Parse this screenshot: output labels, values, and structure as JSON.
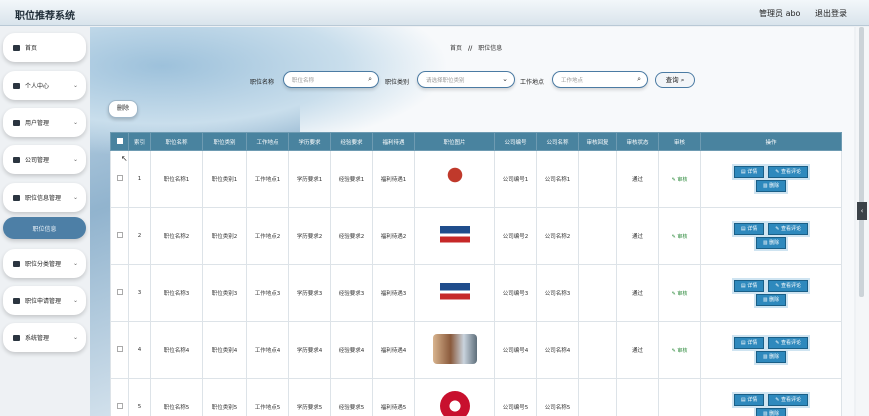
{
  "header": {
    "title": "职位推荐系统",
    "admin": "管理员 abo",
    "logout": "退出登录"
  },
  "sidebar": {
    "items": [
      {
        "label": "首页",
        "icon": "home-icon",
        "chevron": false
      },
      {
        "label": "个人中心",
        "icon": "user-icon",
        "chevron": true
      },
      {
        "label": "用户管理",
        "icon": "shirt-icon",
        "chevron": true
      },
      {
        "label": "公司管理",
        "icon": "building-icon",
        "chevron": true
      },
      {
        "label": "职位信息管理",
        "icon": "grid-icon",
        "chevron": true
      },
      {
        "label": "职位信息",
        "icon": "",
        "chevron": false
      },
      {
        "label": "职位分类管理",
        "icon": "book-icon",
        "chevron": true
      },
      {
        "label": "职位申请管理",
        "icon": "grid-icon",
        "chevron": true
      },
      {
        "label": "系统管理",
        "icon": "monitor-icon",
        "chevron": true
      }
    ]
  },
  "breadcrumb": {
    "home": "首页",
    "sep": "//",
    "current": "职位信息"
  },
  "filters": {
    "name_label": "职位名称",
    "name_placeholder": "职位名称",
    "type_label": "职位类别",
    "type_placeholder": "请选择职位类别",
    "location_label": "工作地点",
    "location_placeholder": "工作地点",
    "query": "查询"
  },
  "toolbar": {
    "delete": "删除"
  },
  "table": {
    "headers": [
      "索引",
      "职位名称",
      "职位类别",
      "工作地点",
      "学历要求",
      "经验要求",
      "福利待遇",
      "职位图片",
      "公司编号",
      "公司名称",
      "审核回复",
      "审核状态",
      "审核",
      "操作"
    ],
    "rows": [
      {
        "idx": "1",
        "name": "职位名称1",
        "type": "职位类别1",
        "loc": "工作地点1",
        "edu": "学历要求1",
        "exp": "经验要求1",
        "welfare": "福利待遇1",
        "img": "brand-logo-red",
        "comp_no": "公司编号1",
        "comp_name": "公司名称1",
        "reply": "",
        "status": "通过",
        "audit": "审核"
      },
      {
        "idx": "2",
        "name": "职位名称2",
        "type": "职位类别2",
        "loc": "工作地点2",
        "edu": "学历要求2",
        "exp": "经验要求2",
        "welfare": "福利待遇2",
        "img": "geely-logo",
        "comp_no": "公司编号2",
        "comp_name": "公司名称2",
        "reply": "",
        "status": "通过",
        "audit": "审核"
      },
      {
        "idx": "3",
        "name": "职位名称3",
        "type": "职位类别3",
        "loc": "工作地点3",
        "edu": "学历要求3",
        "exp": "经验要求3",
        "welfare": "福利待遇3",
        "img": "geely-logo",
        "comp_no": "公司编号3",
        "comp_name": "公司名称3",
        "reply": "",
        "status": "通过",
        "audit": "审核"
      },
      {
        "idx": "4",
        "name": "职位名称4",
        "type": "职位类别4",
        "loc": "工作地点4",
        "edu": "学历要求4",
        "exp": "经验要求4",
        "welfare": "福利待遇4",
        "img": "meeting-photo",
        "comp_no": "公司编号4",
        "comp_name": "公司名称4",
        "reply": "",
        "status": "通过",
        "audit": "审核"
      },
      {
        "idx": "5",
        "name": "职位名称5",
        "type": "职位类别5",
        "loc": "工作地点5",
        "edu": "学历要求5",
        "exp": "经验要求5",
        "welfare": "福利待遇5",
        "img": "kfc-logo",
        "comp_no": "公司编号5",
        "comp_name": "公司名称5",
        "reply": "",
        "status": "",
        "audit": ""
      }
    ],
    "actions": {
      "detail": "详情",
      "review": "查看评论",
      "delete": "删除"
    }
  },
  "colors": {
    "accent": "#49839f",
    "button": "#2e89bd",
    "sidebar_active": "#4d7fa6"
  }
}
